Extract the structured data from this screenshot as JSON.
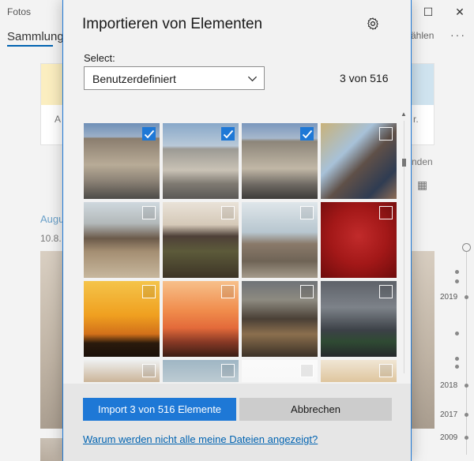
{
  "app": {
    "title": "Fotos",
    "tab_collection": "Sammlung",
    "select_fragment": "ählen",
    "more": "···",
    "win_minimize": "—",
    "win_maximize": "☐",
    "win_close": "✕"
  },
  "background": {
    "card_left_text": "A",
    "card_right_text": "r.",
    "side_text": "nden",
    "date_heading": "Augu",
    "date_sub": "10.8.",
    "timeline_years": [
      "2019",
      "2018",
      "2017",
      "2009"
    ]
  },
  "dialog": {
    "title": "Importieren von Elementen",
    "select_label": "Select:",
    "dropdown_value": "Benutzerdefiniert",
    "count_text": "3 von 516",
    "import_button": "Import 3 von 516 Elemente",
    "cancel_button": "Abbrechen",
    "help_link": "Warum werden nicht alle meine Dateien angezeigt?"
  },
  "thumbnails": [
    {
      "subject": "building-street",
      "selected": true
    },
    {
      "subject": "ornate-building",
      "selected": true
    },
    {
      "subject": "building-cars",
      "selected": true
    },
    {
      "subject": "smiling-people",
      "selected": false
    },
    {
      "subject": "mountain-plain",
      "selected": false
    },
    {
      "subject": "lava-field",
      "selected": false
    },
    {
      "subject": "rock-cairns",
      "selected": false
    },
    {
      "subject": "red-texture",
      "selected": false
    },
    {
      "subject": "bears-sunset",
      "selected": false
    },
    {
      "subject": "sunset-riders",
      "selected": false
    },
    {
      "subject": "waterfall",
      "selected": false
    },
    {
      "subject": "car-on-cliff",
      "selected": false
    },
    {
      "subject": "rocks",
      "selected": false
    },
    {
      "subject": "landscape",
      "selected": false
    },
    {
      "subject": "white",
      "selected": false
    },
    {
      "subject": "desert",
      "selected": false
    }
  ],
  "colors": {
    "accent": "#1e78d6",
    "link": "#0063b1"
  }
}
